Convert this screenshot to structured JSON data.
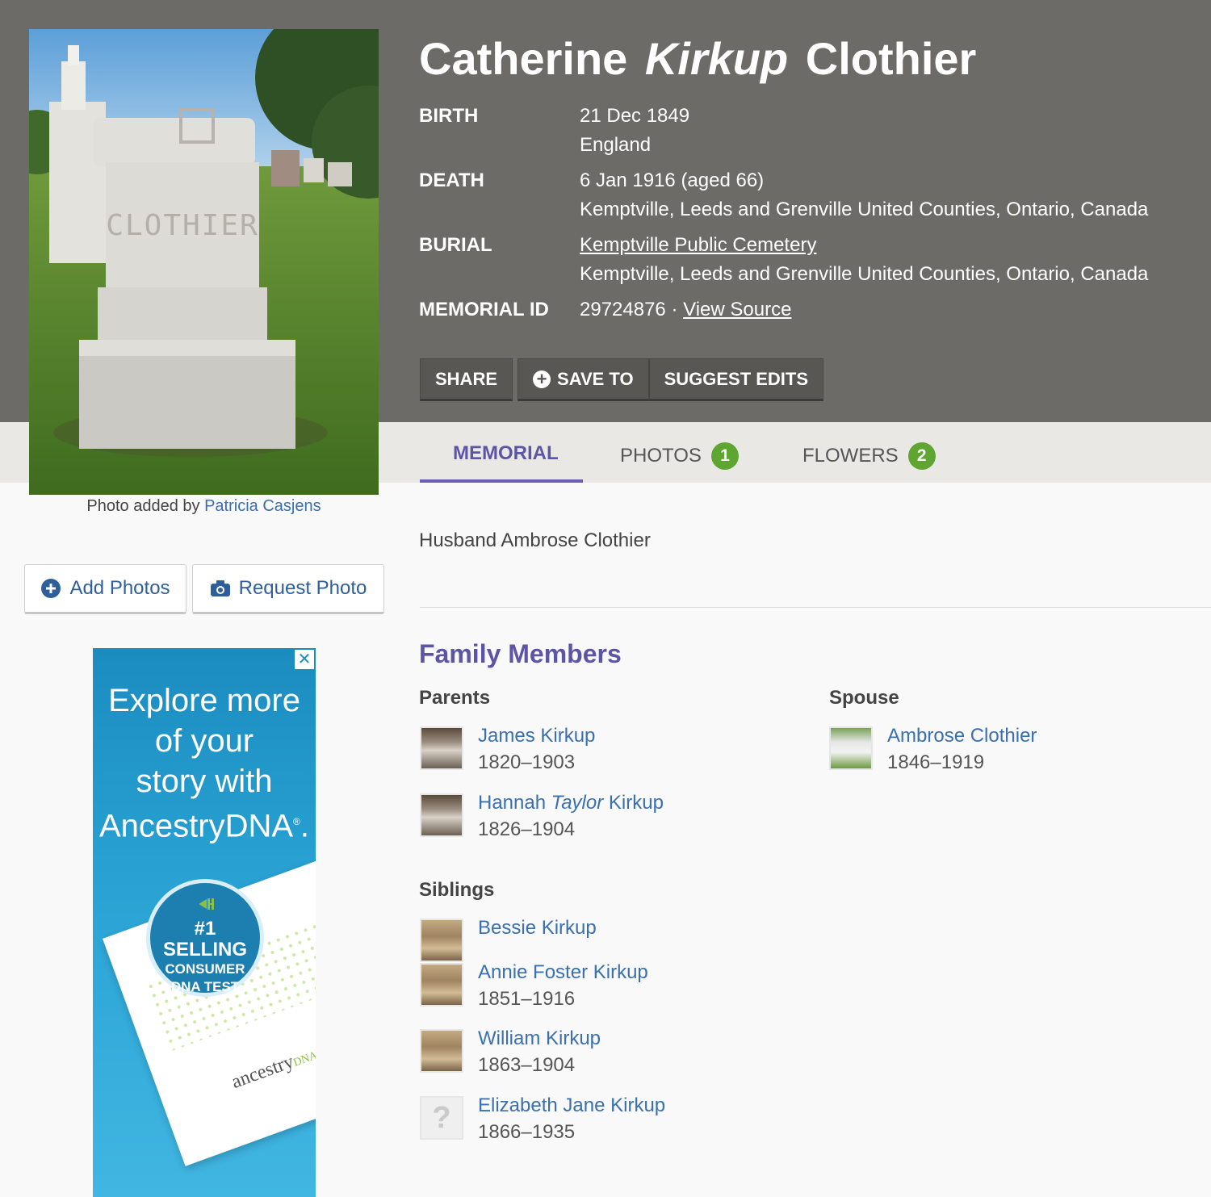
{
  "memorial": {
    "first_name": "Catherine",
    "maiden_name": "Kirkup",
    "last_name": "Clothier",
    "facts": {
      "birth_label": "BIRTH",
      "birth_date": "21 Dec 1849",
      "birth_place": "England",
      "death_label": "DEATH",
      "death_date": "6 Jan 1916 (aged 66)",
      "death_place": "Kemptville, Leeds and Grenville United Counties, Ontario, Canada",
      "burial_label": "BURIAL",
      "burial_cemetery": "Kemptville Public Cemetery",
      "burial_place": "Kemptville, Leeds and Grenville United Counties, Ontario, Canada",
      "memorial_id_label": "MEMORIAL ID",
      "memorial_id": "29724876 ·",
      "view_source": "View Source"
    },
    "actions": {
      "share": "SHARE",
      "save_to": "SAVE TO",
      "suggest_edits": "SUGGEST EDITS"
    }
  },
  "photo": {
    "stone_text": "CLOTHIER",
    "caption_prefix": "Photo added by",
    "caption_author": "Patricia Casjens",
    "add_photos": "Add Photos",
    "request_photo": "Request Photo"
  },
  "tabs": [
    {
      "label": "MEMORIAL"
    },
    {
      "label": "PHOTOS",
      "count": "1"
    },
    {
      "label": "FLOWERS",
      "count": "2"
    }
  ],
  "bio": "Husband Ambrose Clothier",
  "family": {
    "title": "Family Members",
    "parents_label": "Parents",
    "spouse_label": "Spouse",
    "siblings_label": "Siblings",
    "parents": [
      {
        "first": "James",
        "middle": "",
        "last": "Kirkup",
        "dates": "1820–1903"
      },
      {
        "first": "Hannah",
        "middle": "Taylor",
        "last": "Kirkup",
        "dates": "1826–1904"
      }
    ],
    "spouse": [
      {
        "first": "Ambrose",
        "last": "Clothier",
        "dates": "1846–1919"
      }
    ],
    "siblings": [
      {
        "name": "Bessie Kirkup",
        "dates": ""
      },
      {
        "name": "Annie Foster Kirkup",
        "dates": "1851–1916"
      },
      {
        "name": "William Kirkup",
        "dates": "1863–1904"
      },
      {
        "name": "Elizabeth Jane Kirkup",
        "dates": "1866–1935"
      }
    ]
  },
  "ad": {
    "headline_1": "Explore more",
    "headline_2": "of your",
    "headline_3": "story with",
    "headline_4": "AncestryDNA",
    "reg_mark": "®",
    "headline_end": ".",
    "badge_1": "#1 SELLING",
    "badge_2": "CONSUMER",
    "badge_3": "DNA TEST",
    "brand": "ancestry",
    "brand_suffix": "DNA",
    "close": "✕"
  },
  "colors": {
    "header_bg": "#6d6b67",
    "accent_purple": "#5c55a5",
    "link_blue": "#3a6fb0",
    "badge_green": "#5ea532"
  }
}
